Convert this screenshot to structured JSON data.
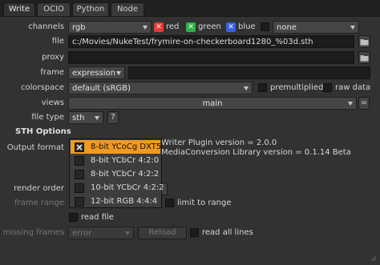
{
  "tabs": [
    "Write",
    "OCIO",
    "Python",
    "Node"
  ],
  "channels": {
    "label": "channels",
    "value": "rgb",
    "red": "red",
    "green": "green",
    "blue": "blue",
    "extra": "none",
    "colors": {
      "red": "#e83a3a",
      "green": "#2fb24a",
      "blue": "#3a5fe8"
    }
  },
  "file": {
    "label": "file",
    "value": "c:/Movies/NukeTest/frymire-on-checkerboard1280_%03d.sth"
  },
  "proxy": {
    "label": "proxy",
    "value": ""
  },
  "frame": {
    "label": "frame",
    "mode": "expression",
    "value": ""
  },
  "colorspace": {
    "label": "colorspace",
    "value": "default (sRGB)",
    "premultiplied": "premultiplied",
    "raw_data": "raw data"
  },
  "views": {
    "label": "views",
    "value": "main",
    "eq": "="
  },
  "file_type": {
    "label": "file type",
    "value": "sth",
    "help": "?"
  },
  "sth_options": {
    "title": "STH Options"
  },
  "output_format": {
    "label": "Output format",
    "info_line1": "Writer Plugin version = 2.0.0",
    "info_line2": "MediaConversion Library version = 0.1.14 Beta",
    "options": [
      "8-bit YCoCg DXT5",
      "8-bit YCbCr 4:2:0",
      "8-bit YCbCr 4:2:2",
      "10-bit YCbCr 4:2:2",
      "12-bit RGB 4:4:4"
    ],
    "selected_index": 0
  },
  "render_order": {
    "label": "render order"
  },
  "frame_range": {
    "label": "frame range",
    "limit_to_range": "limit to range"
  },
  "read_file": {
    "label": "read file"
  },
  "missing_frames": {
    "label": "missing frames",
    "value": "error",
    "reload": "Reload",
    "read_all_lines": "read all lines"
  },
  "accent_color": "#f09a23"
}
